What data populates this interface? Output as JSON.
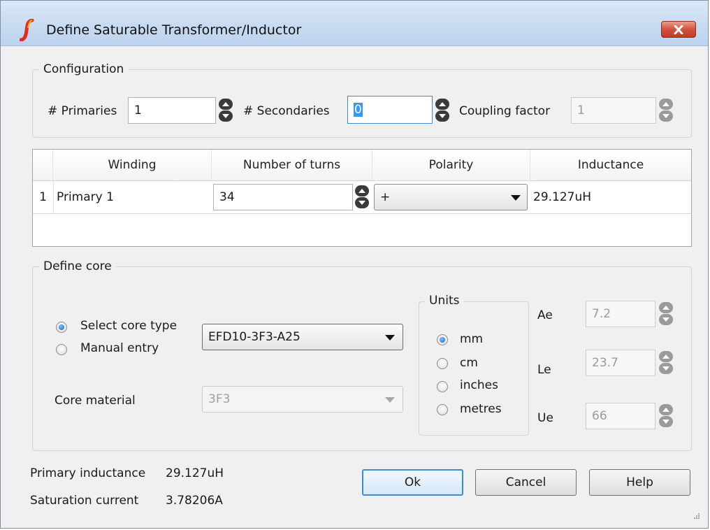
{
  "window": {
    "title": "Define Saturable Transformer/Inductor",
    "icon": "simetrix-logo-icon",
    "close_icon": "close-icon"
  },
  "configuration": {
    "legend": "Configuration",
    "primaries_label": "# Primaries",
    "primaries_value": "1",
    "secondaries_label": "# Secondaries",
    "secondaries_value": "0",
    "coupling_label": "Coupling factor",
    "coupling_value": "1"
  },
  "windings_table": {
    "columns": [
      "Winding",
      "Number of turns",
      "Polarity",
      "Inductance"
    ],
    "rows": [
      {
        "index": "1",
        "winding": "Primary 1",
        "turns": "34",
        "polarity": "+",
        "inductance": "29.127uH"
      }
    ]
  },
  "core": {
    "legend": "Define core",
    "select_core_type_label": "Select core type",
    "manual_entry_label": "Manual entry",
    "selected_mode": "select_core_type",
    "core_type_value": "EFD10-3F3-A25",
    "core_material_label": "Core material",
    "core_material_value": "3F3",
    "units": {
      "legend": "Units",
      "options": [
        "mm",
        "cm",
        "inches",
        "metres"
      ],
      "selected": "mm"
    },
    "ae_label": "Ae",
    "ae_value": "7.2",
    "le_label": "Le",
    "le_value": "23.7",
    "ue_label": "Ue",
    "ue_value": "66"
  },
  "summary": {
    "primary_inductance_label": "Primary inductance",
    "primary_inductance_value": "29.127uH",
    "saturation_current_label": "Saturation current",
    "saturation_current_value": "3.78206A"
  },
  "buttons": {
    "ok": "Ok",
    "cancel": "Cancel",
    "help": "Help"
  },
  "colors": {
    "title_bar": "#c7daf0",
    "close_button": "#d2513a",
    "focus_border": "#3a8cd8",
    "radio_selected": "#1560b8"
  }
}
